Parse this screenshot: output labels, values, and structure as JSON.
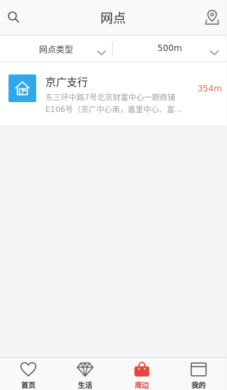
{
  "header": {
    "title": "网点"
  },
  "filters": {
    "type_label": "网点类型",
    "distance_label": "500m"
  },
  "branches": [
    {
      "name": "京广支行",
      "address": "东三环中路7号北京财富中心一期商铺E106号（京广中心南，嘉里中心、富…",
      "distance": "354m"
    }
  ],
  "tabs": [
    {
      "label": "首页",
      "icon": "heart-icon"
    },
    {
      "label": "生活",
      "icon": "diamond-icon"
    },
    {
      "label": "周边",
      "icon": "bag-icon",
      "active": true
    },
    {
      "label": "我的",
      "icon": "card-icon"
    }
  ],
  "colors": {
    "accent": "#e8473f",
    "branch_icon_bg": "#2ea7ec",
    "distance": "#f0645a"
  }
}
